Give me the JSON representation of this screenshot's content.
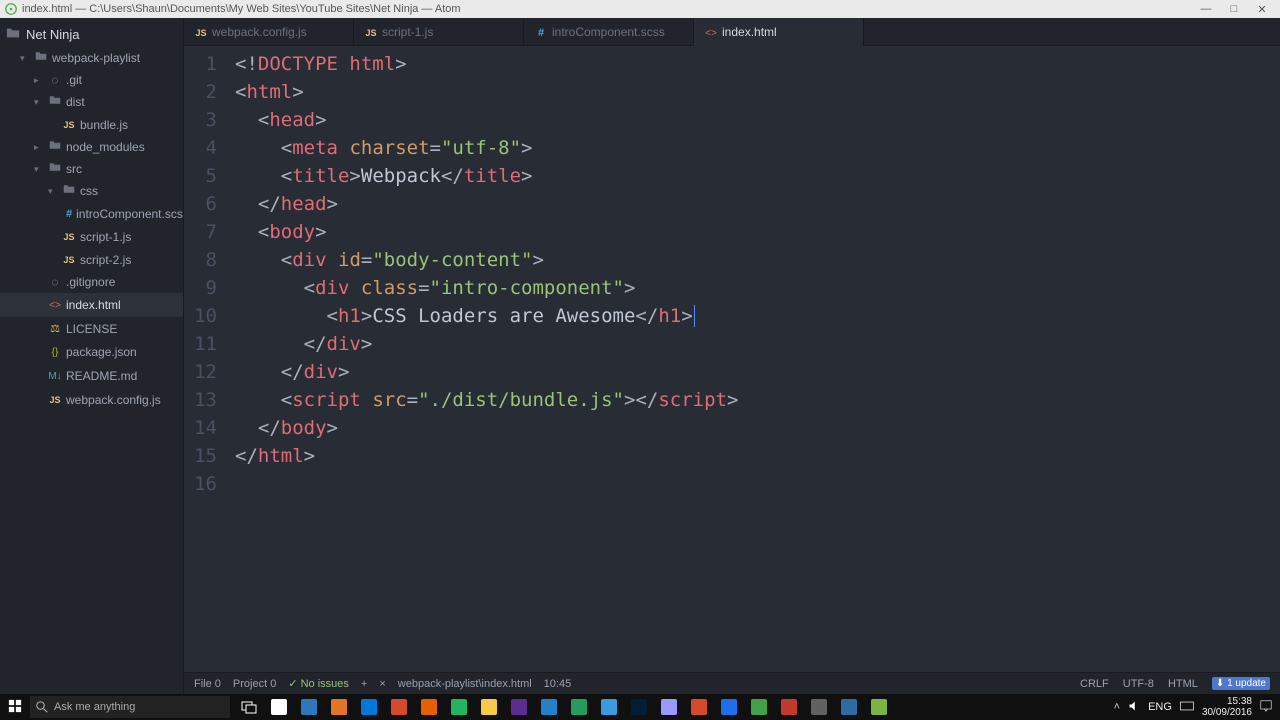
{
  "window": {
    "title": "index.html — C:\\Users\\Shaun\\Documents\\My Web Sites\\YouTube Sites\\Net Ninja — Atom"
  },
  "sidebar": {
    "root": "Net Ninja",
    "items": [
      {
        "depth": 1,
        "chev": "▾",
        "icon": "folder",
        "label": "webpack-playlist"
      },
      {
        "depth": 2,
        "chev": "▸",
        "icon": "git",
        "label": ".git"
      },
      {
        "depth": 2,
        "chev": "▾",
        "icon": "folder",
        "label": "dist"
      },
      {
        "depth": 3,
        "chev": "",
        "icon": "js",
        "label": "bundle.js"
      },
      {
        "depth": 2,
        "chev": "▸",
        "icon": "folder",
        "label": "node_modules"
      },
      {
        "depth": 2,
        "chev": "▾",
        "icon": "folder",
        "label": "src"
      },
      {
        "depth": 3,
        "chev": "▾",
        "icon": "folder",
        "label": "css"
      },
      {
        "depth": 4,
        "chev": "",
        "icon": "css",
        "label": "introComponent.scss"
      },
      {
        "depth": 3,
        "chev": "",
        "icon": "js",
        "label": "script-1.js"
      },
      {
        "depth": 3,
        "chev": "",
        "icon": "js",
        "label": "script-2.js"
      },
      {
        "depth": 2,
        "chev": "",
        "icon": "git",
        "label": ".gitignore"
      },
      {
        "depth": 2,
        "chev": "",
        "icon": "html",
        "label": "index.html",
        "selected": true
      },
      {
        "depth": 2,
        "chev": "",
        "icon": "lic",
        "label": "LICENSE"
      },
      {
        "depth": 2,
        "chev": "",
        "icon": "json",
        "label": "package.json"
      },
      {
        "depth": 2,
        "chev": "",
        "icon": "md",
        "label": "README.md"
      },
      {
        "depth": 2,
        "chev": "",
        "icon": "js",
        "label": "webpack.config.js"
      }
    ]
  },
  "tabs": [
    {
      "icon": "js",
      "label": "webpack.config.js"
    },
    {
      "icon": "js",
      "label": "script-1.js"
    },
    {
      "icon": "css",
      "label": "introComponent.scss"
    },
    {
      "icon": "html",
      "label": "index.html",
      "active": true
    }
  ],
  "code": {
    "lines": [
      [
        {
          "p": "<!"
        },
        {
          "t": "DOCTYPE html"
        },
        {
          "p": ">"
        }
      ],
      [
        {
          "p": "<"
        },
        {
          "t": "html"
        },
        {
          "p": ">"
        }
      ],
      [
        {
          "sp": 1
        },
        {
          "p": "<"
        },
        {
          "t": "head"
        },
        {
          "p": ">"
        }
      ],
      [
        {
          "sp": 2
        },
        {
          "p": "<"
        },
        {
          "t": "meta"
        },
        {
          "tx": " "
        },
        {
          "a": "charset"
        },
        {
          "p": "="
        },
        {
          "s": "\"utf-8\""
        },
        {
          "p": ">"
        }
      ],
      [
        {
          "sp": 2
        },
        {
          "p": "<"
        },
        {
          "t": "title"
        },
        {
          "p": ">"
        },
        {
          "tx": "Webpack"
        },
        {
          "p": "</"
        },
        {
          "t": "title"
        },
        {
          "p": ">"
        }
      ],
      [
        {
          "sp": 1
        },
        {
          "p": "</"
        },
        {
          "t": "head"
        },
        {
          "p": ">"
        }
      ],
      [
        {
          "sp": 1
        },
        {
          "p": "<"
        },
        {
          "t": "body"
        },
        {
          "p": ">"
        }
      ],
      [
        {
          "sp": 2
        },
        {
          "p": "<"
        },
        {
          "t": "div"
        },
        {
          "tx": " "
        },
        {
          "a": "id"
        },
        {
          "p": "="
        },
        {
          "s": "\"body-content\""
        },
        {
          "p": ">"
        }
      ],
      [
        {
          "sp": 3
        },
        {
          "p": "<"
        },
        {
          "t": "div"
        },
        {
          "tx": " "
        },
        {
          "a": "class"
        },
        {
          "p": "="
        },
        {
          "s": "\"intro-component\""
        },
        {
          "p": ">"
        }
      ],
      [
        {
          "sp": 4
        },
        {
          "p": "<"
        },
        {
          "t": "h1"
        },
        {
          "p": ">"
        },
        {
          "tx": "CSS Loaders are Awesome"
        },
        {
          "p": "</"
        },
        {
          "t": "h1"
        },
        {
          "p": ">"
        },
        {
          "cursor": true
        }
      ],
      [
        {
          "sp": 3
        },
        {
          "p": "</"
        },
        {
          "t": "div"
        },
        {
          "p": ">"
        }
      ],
      [
        {
          "sp": 2
        },
        {
          "p": "</"
        },
        {
          "t": "div"
        },
        {
          "p": ">"
        }
      ],
      [
        {
          "sp": 2
        },
        {
          "p": "<"
        },
        {
          "t": "script"
        },
        {
          "tx": " "
        },
        {
          "a": "src"
        },
        {
          "p": "="
        },
        {
          "s": "\"./dist/bundle.js\""
        },
        {
          "p": ">"
        },
        {
          "p": "</"
        },
        {
          "t": "script"
        },
        {
          "p": ">"
        }
      ],
      [
        {
          "sp": 1
        },
        {
          "p": "</"
        },
        {
          "t": "body"
        },
        {
          "p": ">"
        }
      ],
      [
        {
          "p": "</"
        },
        {
          "t": "html"
        },
        {
          "p": ">"
        }
      ],
      [
        {
          "tx": ""
        }
      ]
    ]
  },
  "status": {
    "file": "File  0",
    "project": "Project  0",
    "issues": "✓ No issues",
    "plus": "+",
    "close": "×",
    "path": "webpack-playlist\\index.html",
    "cursor": "10:45",
    "eol": "CRLF",
    "encoding": "UTF-8",
    "grammar": "HTML",
    "updates_icon": "⬇",
    "updates": "1 update"
  },
  "taskbar": {
    "search_placeholder": "Ask me anything",
    "clock_time": "15:38",
    "clock_date": "30/09/2016",
    "lang": "ENG",
    "icons": [
      "#ffffff",
      "#2e77bb",
      "#e07628",
      "#0078d7",
      "#d44a2c",
      "#e66000",
      "#24b35f",
      "#f7c948",
      "#5c2d91",
      "#2481c8",
      "#259b5e",
      "#3a9bdc",
      "#001e36",
      "#9999ff",
      "#d44a2c",
      "#1f6feb",
      "#43a047",
      "#c0392b",
      "#616161",
      "#2d6ca2",
      "#7cb342"
    ]
  }
}
